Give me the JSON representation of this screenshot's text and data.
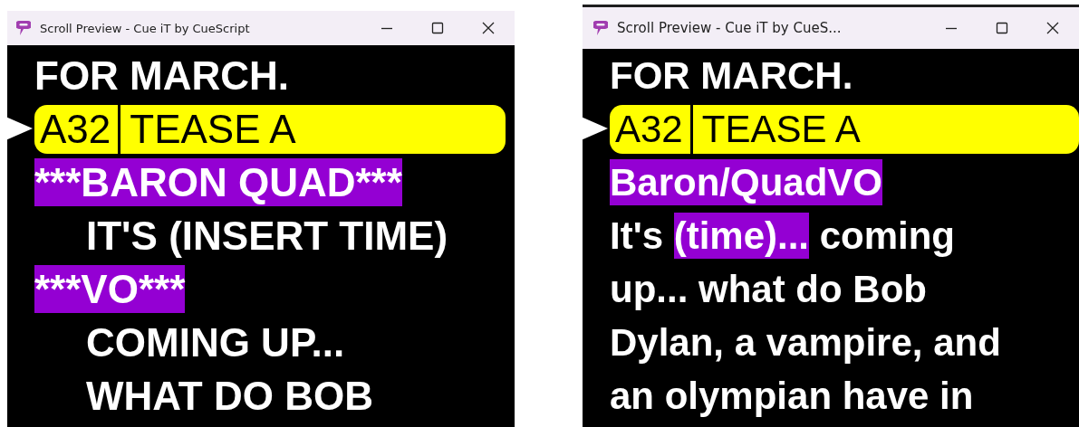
{
  "windows": [
    {
      "title": "Scroll Preview - Cue iT by CueScript",
      "lines": [
        {
          "kind": "text",
          "indent": false,
          "segments": [
            {
              "text": "FOR MARCH.",
              "highlight": false
            }
          ]
        },
        {
          "kind": "cue",
          "current": true,
          "number": "A32",
          "text": "TEASE A"
        },
        {
          "kind": "text",
          "indent": false,
          "segments": [
            {
              "text": "***BARON QUAD***",
              "highlight": true
            }
          ]
        },
        {
          "kind": "text",
          "indent": true,
          "segments": [
            {
              "text": "IT'S (INSERT TIME)",
              "highlight": false
            }
          ]
        },
        {
          "kind": "text",
          "indent": false,
          "segments": [
            {
              "text": "***VO***",
              "highlight": true
            }
          ]
        },
        {
          "kind": "text",
          "indent": true,
          "segments": [
            {
              "text": "COMING UP...",
              "highlight": false
            }
          ]
        },
        {
          "kind": "text",
          "indent": true,
          "segments": [
            {
              "text": "WHAT DO BOB",
              "highlight": false
            }
          ]
        }
      ]
    },
    {
      "title": "Scroll Preview - Cue iT by CueS...",
      "lines": [
        {
          "kind": "text",
          "indent": false,
          "segments": [
            {
              "text": "FOR MARCH.",
              "highlight": false
            }
          ]
        },
        {
          "kind": "cue",
          "current": true,
          "number": "A32",
          "text": "TEASE A"
        },
        {
          "kind": "text",
          "indent": false,
          "segments": [
            {
              "text": "Baron/QuadVO",
              "highlight": true
            }
          ]
        },
        {
          "kind": "text",
          "indent": false,
          "segments": [
            {
              "text": "It's ",
              "highlight": false
            },
            {
              "text": "(time)...",
              "highlight": true
            },
            {
              "text": " coming",
              "highlight": false
            }
          ]
        },
        {
          "kind": "text",
          "indent": false,
          "segments": [
            {
              "text": "up... what do Bob",
              "highlight": false
            }
          ]
        },
        {
          "kind": "text",
          "indent": false,
          "segments": [
            {
              "text": "Dylan, a vampire, and",
              "highlight": false
            }
          ]
        },
        {
          "kind": "text",
          "indent": false,
          "segments": [
            {
              "text": "an olympian have in",
              "highlight": false
            }
          ]
        }
      ]
    }
  ]
}
